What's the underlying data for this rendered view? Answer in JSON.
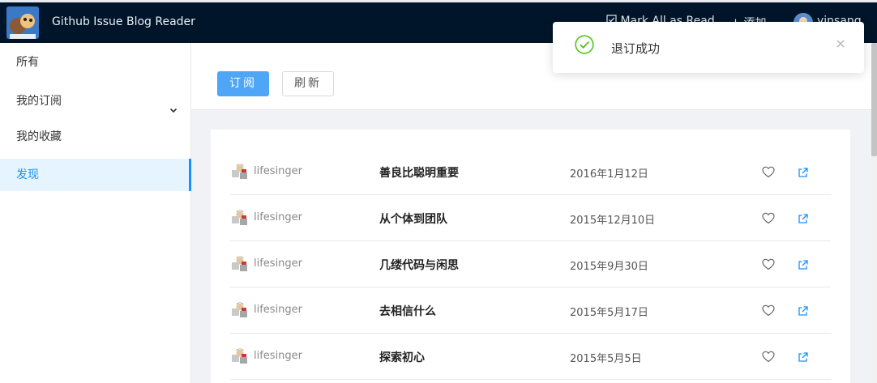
{
  "app": {
    "title": "Github Issue Blog Reader"
  },
  "header": {
    "mark_all_label": "Mark All as Read",
    "add_label": "添加",
    "user_name": "yinsang"
  },
  "sidebar": {
    "items": [
      {
        "label": "所有",
        "active": false
      },
      {
        "label": "我的订阅",
        "active": false,
        "expandable": true
      },
      {
        "label": "我的收藏",
        "active": false
      },
      {
        "label": "发现",
        "active": true
      }
    ]
  },
  "toolbar": {
    "subscribe_label": "订阅",
    "refresh_label": "刷新"
  },
  "posts": [
    {
      "author": "lifesinger",
      "title": "善良比聪明重要",
      "date": "2016年1月12日"
    },
    {
      "author": "lifesinger",
      "title": "从个体到团队",
      "date": "2015年12月10日"
    },
    {
      "author": "lifesinger",
      "title": "几缕代码与闲思",
      "date": "2015年9月30日"
    },
    {
      "author": "lifesinger",
      "title": "去相信什么",
      "date": "2015年5月17日"
    },
    {
      "author": "lifesinger",
      "title": "探索初心",
      "date": "2015年5月5日"
    }
  ],
  "toast": {
    "message": "退订成功",
    "type": "success"
  },
  "colors": {
    "topbar": "#001529",
    "primary": "#1890ff",
    "button_primary": "#50a6f6",
    "success": "#52c41a",
    "active_bg": "#e6f4ff"
  },
  "icons": {
    "logo": "logo-icon",
    "mark_all": "check-square-icon",
    "add": "plus-icon",
    "favorite": "heart-icon",
    "open": "external-link-icon",
    "toast": "check-circle-icon",
    "close": "close-icon",
    "expand": "chevron-down-icon"
  }
}
